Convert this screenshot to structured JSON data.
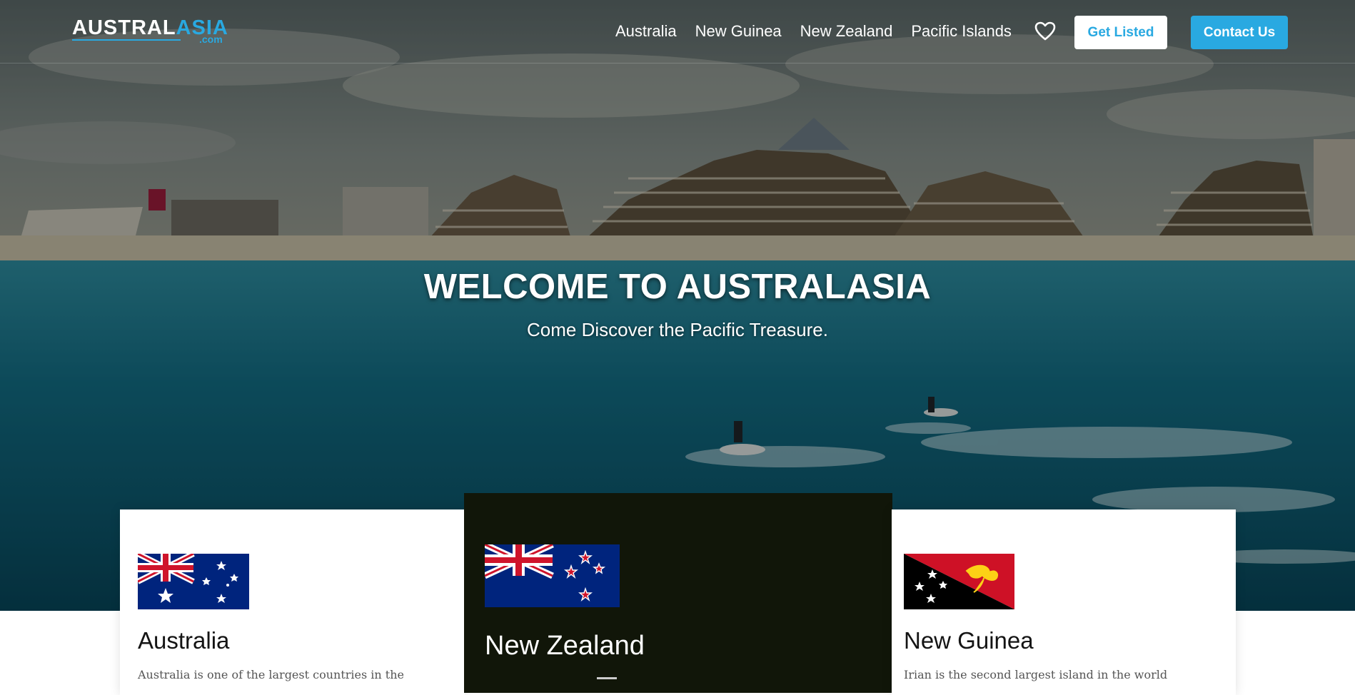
{
  "header": {
    "logo": {
      "text_main": "AUSTRAL",
      "text_accent": "ASIA",
      "text_sub": ".com"
    },
    "nav": [
      "Australia",
      "New Guinea",
      "New Zealand",
      "Pacific Islands"
    ],
    "favorites_icon": "heart-icon",
    "get_listed_label": "Get Listed",
    "contact_label": "Contact Us"
  },
  "hero": {
    "title": "WELCOME TO AUSTRALASIA",
    "subtitle": "Come Discover the Pacific Treasure."
  },
  "cards": [
    {
      "id": "australia",
      "title": "Australia",
      "text": "Australia is one of the largest countries in the",
      "flag_icon": "australia-flag-icon"
    },
    {
      "id": "new-zealand",
      "title": "New Zealand",
      "text": "",
      "flag_icon": "new-zealand-flag-icon"
    },
    {
      "id": "new-guinea",
      "title": "New Guinea",
      "text": "Irian is the second largest island in the world",
      "flag_icon": "papua-new-guinea-flag-icon"
    }
  ],
  "colors": {
    "accent": "#29a9e1",
    "nz_card_bg": "#111609",
    "text_dark": "#141414"
  }
}
